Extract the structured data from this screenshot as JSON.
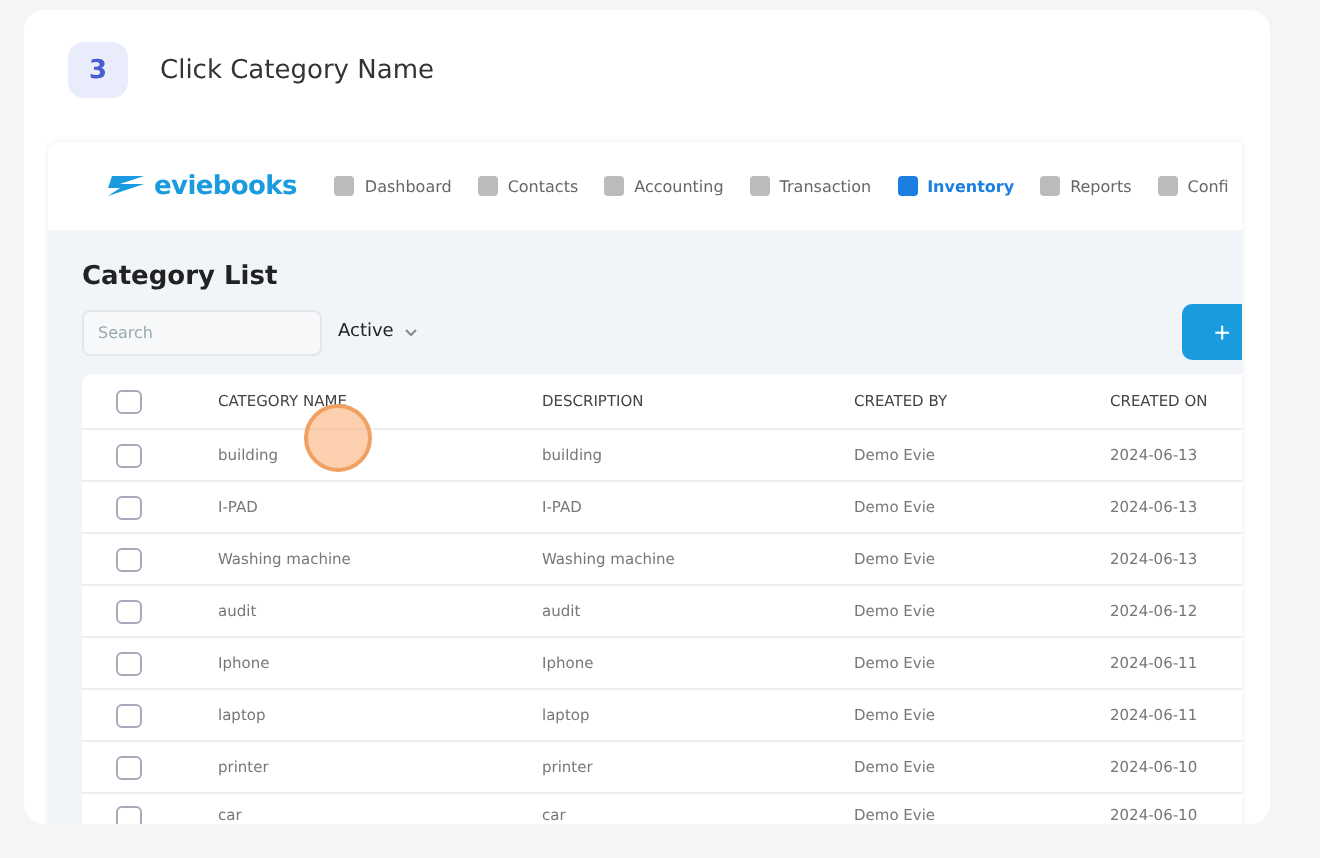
{
  "step": {
    "number": "3",
    "instruction": "Click Category Name"
  },
  "app": {
    "logo": "eviebooks",
    "nav": [
      {
        "label": "Dashboard",
        "selected": false
      },
      {
        "label": "Contacts",
        "selected": false
      },
      {
        "label": "Accounting",
        "selected": false
      },
      {
        "label": "Transaction",
        "selected": false
      },
      {
        "label": "Inventory",
        "selected": true
      },
      {
        "label": "Reports",
        "selected": false
      },
      {
        "label": "Confi",
        "selected": false
      }
    ],
    "page_title": "Category List",
    "search": {
      "placeholder": "Search"
    },
    "status_filter": "Active",
    "add_button": "+",
    "table": {
      "select_all_checked": false,
      "columns": [
        "CATEGORY NAME",
        "DESCRIPTION",
        "CREATED BY",
        "CREATED ON"
      ],
      "rows": [
        {
          "checked": false,
          "cells": [
            "building",
            "building",
            "Demo Evie",
            "2024-06-13"
          ]
        },
        {
          "checked": false,
          "cells": [
            "I-PAD",
            "I-PAD",
            "Demo Evie",
            "2024-06-13"
          ]
        },
        {
          "checked": false,
          "cells": [
            "Washing machine",
            "Washing machine",
            "Demo Evie",
            "2024-06-13"
          ]
        },
        {
          "checked": false,
          "cells": [
            "audit",
            "audit",
            "Demo Evie",
            "2024-06-12"
          ]
        },
        {
          "checked": false,
          "cells": [
            "Iphone",
            "Iphone",
            "Demo Evie",
            "2024-06-11"
          ]
        },
        {
          "checked": false,
          "cells": [
            "laptop",
            "laptop",
            "Demo Evie",
            "2024-06-11"
          ]
        },
        {
          "checked": false,
          "cells": [
            "printer",
            "printer",
            "Demo Evie",
            "2024-06-10"
          ]
        },
        {
          "checked": false,
          "cells": [
            "car",
            "car",
            "Demo Evie",
            "2024-06-10"
          ]
        }
      ]
    }
  }
}
